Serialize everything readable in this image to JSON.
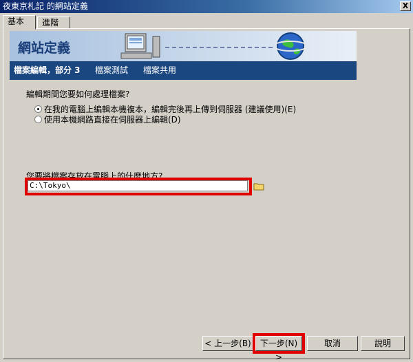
{
  "window": {
    "title": "夜東京札記 的網站定義",
    "close_label": "X"
  },
  "tabs": [
    {
      "label": "基本"
    },
    {
      "label": "進階"
    }
  ],
  "banner": {
    "title": "網站定義"
  },
  "nav": {
    "items": [
      {
        "label": "檔案編輯，部分 3"
      },
      {
        "label": "檔案測試"
      },
      {
        "label": "檔案共用"
      }
    ]
  },
  "question": "編輯期間您要如何處理檔案?",
  "options": [
    {
      "label": "在我的電腦上編輯本機複本，編輯完後再上傳到伺服器 (建議使用)(E)",
      "checked": true
    },
    {
      "label": "使用本機網路直接在伺服器上編輯(D)",
      "checked": false
    }
  ],
  "path": {
    "label": "您要將檔案存放在電腦上的什麼地方?",
    "value": "C:\\Tokyo\\"
  },
  "buttons": {
    "back": "< 上一步(B)",
    "next": "下一步(N) >",
    "cancel": "取消",
    "help": "說明"
  }
}
